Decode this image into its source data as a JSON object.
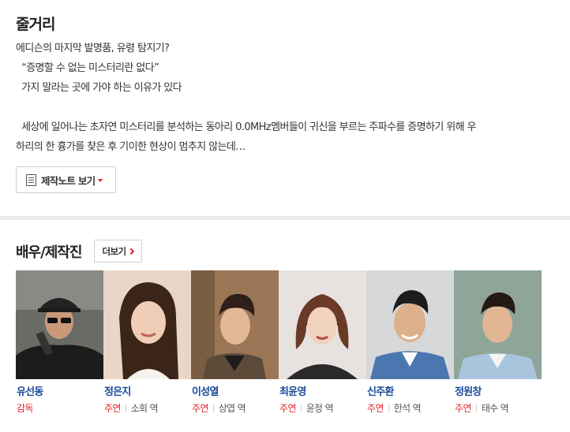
{
  "synopsis": {
    "title": "줄거리",
    "lines": [
      "에디슨의 마지막 발명품, 유령 탐지기?",
      "  “증명할 수 없는 미스터리란 없다”",
      "  가지 말라는 곳에 가야 하는 이유가 있다",
      "",
      "  세상에 일어나는 초자연 미스터리를 분석하는 동아리 0.0MHz멤버들이 귀신을 부르는 주파수를 증명하기 위해 우",
      "하리의 한 흉가를 찾은 후 기이한 현상이 멈추지 않는데…"
    ],
    "note_button": "제작노트 보기"
  },
  "cast_section": {
    "title": "배우/제작진",
    "more_button": "더보기",
    "members": [
      {
        "name": "유선동",
        "role": "감독",
        "character": ""
      },
      {
        "name": "정은지",
        "role": "주연",
        "character": "소희 역"
      },
      {
        "name": "이성열",
        "role": "주연",
        "character": "상엽 역"
      },
      {
        "name": "최윤영",
        "role": "주연",
        "character": "윤정 역"
      },
      {
        "name": "신주환",
        "role": "주연",
        "character": "한석 역"
      },
      {
        "name": "정원창",
        "role": "주연",
        "character": "태수 역"
      }
    ]
  },
  "colors": {
    "accent_red": "#e0242d",
    "name_blue": "#1a4a9a"
  }
}
